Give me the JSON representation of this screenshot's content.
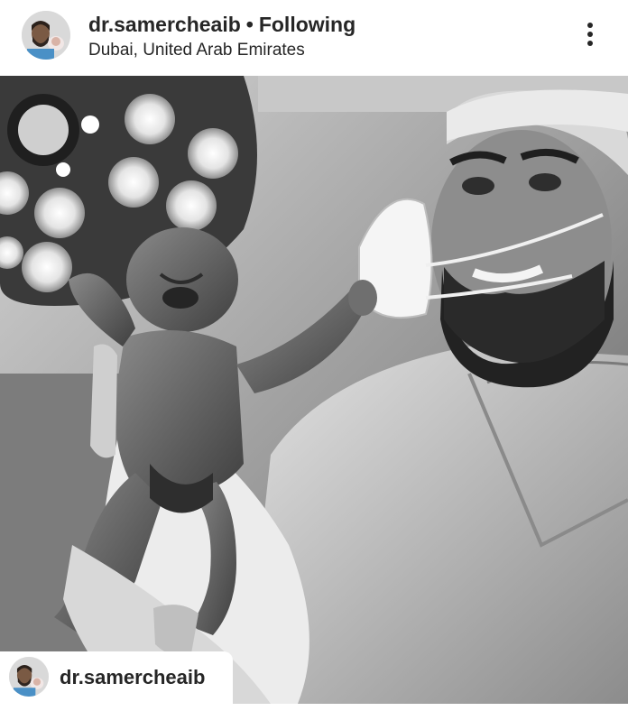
{
  "post": {
    "username": "dr.samercheaib",
    "separator": "•",
    "follow_status": "Following",
    "location": "Dubai, United Arab Emirates"
  },
  "menu": {
    "icon": "more-vertical-icon"
  },
  "photo": {
    "description_icon": "photo"
  },
  "tag": {
    "username": "dr.samercheaib"
  },
  "colors": {
    "text": "#262626",
    "background": "#ffffff"
  }
}
